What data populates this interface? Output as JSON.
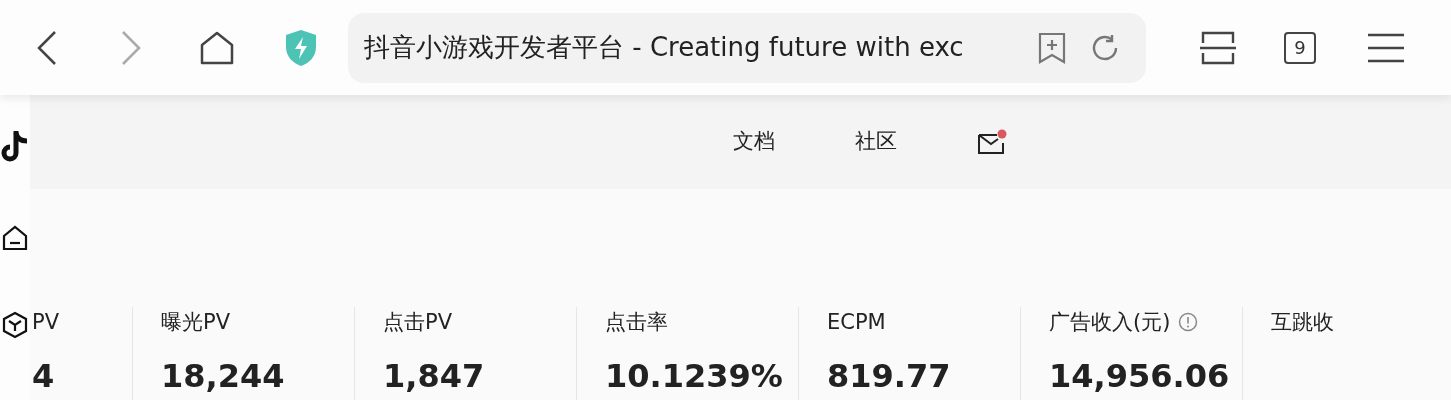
{
  "browser": {
    "page_title": "抖音小游戏开发者平台 - Creating future with exc",
    "tab_count": "9"
  },
  "header": {
    "nav": [
      {
        "label": "文档",
        "kind": "link"
      },
      {
        "label": "社区",
        "kind": "link"
      },
      {
        "kind": "mail",
        "unread": true
      }
    ]
  },
  "metrics": [
    {
      "label": "PV",
      "value": "4"
    },
    {
      "label": "曝光PV",
      "value": "18,244"
    },
    {
      "label": "点击PV",
      "value": "1,847"
    },
    {
      "label": "点击率",
      "value": "10.1239%"
    },
    {
      "label": "ECPM",
      "value": "819.77"
    },
    {
      "label": "广告收入(元)",
      "value": "14,956.06",
      "info": true
    },
    {
      "label": "互跳收"
    }
  ]
}
